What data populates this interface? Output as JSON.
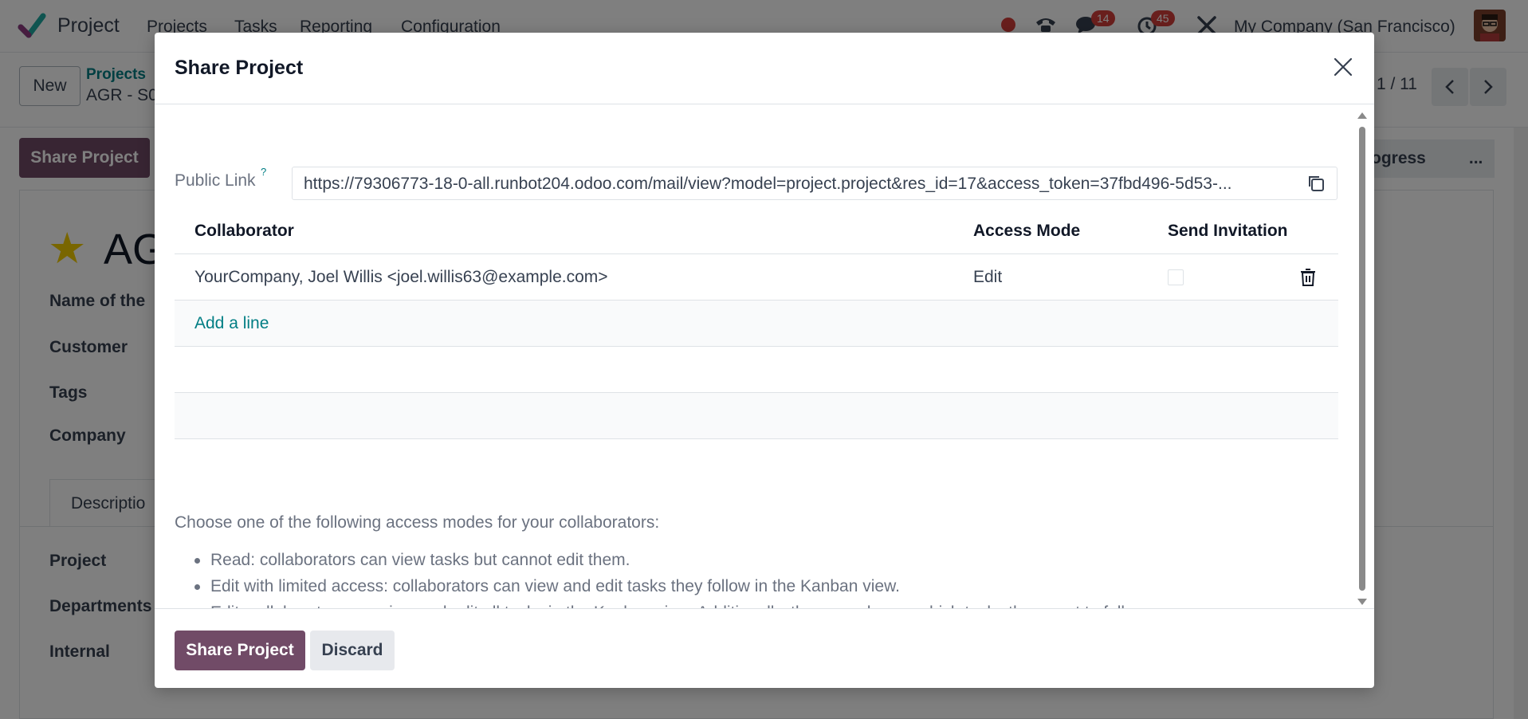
{
  "navbar": {
    "app_name": "Project",
    "menu": [
      "Projects",
      "Tasks",
      "Reporting",
      "Configuration"
    ],
    "chat_badge": "14",
    "activity_badge": "45",
    "company": "My Company (San Francisco)"
  },
  "control_panel": {
    "new_label": "New",
    "breadcrumb_parent": "Projects",
    "breadcrumb_current": "AGR - S0",
    "pager": "1 / 11"
  },
  "form_bg": {
    "share_button": "Share Project",
    "stage_text": "ogress",
    "stage_more": "...",
    "title_partial": "AG",
    "fields": [
      "Name of the",
      "Customer",
      "Tags",
      "Company"
    ],
    "tab_label": "Descriptio",
    "lower_fields": [
      "Project",
      "Departments",
      "Internal"
    ]
  },
  "modal": {
    "title": "Share Project",
    "public_link_label": "Public Link",
    "public_link_help": "?",
    "public_link_value": "https://79306773-18-0-all.runbot204.odoo.com/mail/view?model=project.project&res_id=17&access_token=37fbd496-5d53-...",
    "table": {
      "headers": {
        "collaborator": "Collaborator",
        "access_mode": "Access Mode",
        "send_invitation": "Send Invitation"
      },
      "rows": [
        {
          "collaborator": "YourCompany, Joel Willis <joel.willis63@example.com>",
          "access_mode": "Edit",
          "send_invitation": false
        }
      ],
      "add_line_label": "Add a line"
    },
    "help_intro": "Choose one of the following access modes for your collaborators:",
    "help_items": [
      "Read: collaborators can view tasks but cannot edit them.",
      "Edit with limited access: collaborators can view and edit tasks they follow in the Kanban view.",
      "Edit: collaborators can view and edit all tasks in the Kanban view. Additionally, they can choose which tasks they want to follow."
    ],
    "footer": {
      "primary_label": "Share Project",
      "secondary_label": "Discard"
    }
  },
  "colors": {
    "brand": "#714b67",
    "link": "#017e84",
    "badge": "#d23f3a"
  }
}
